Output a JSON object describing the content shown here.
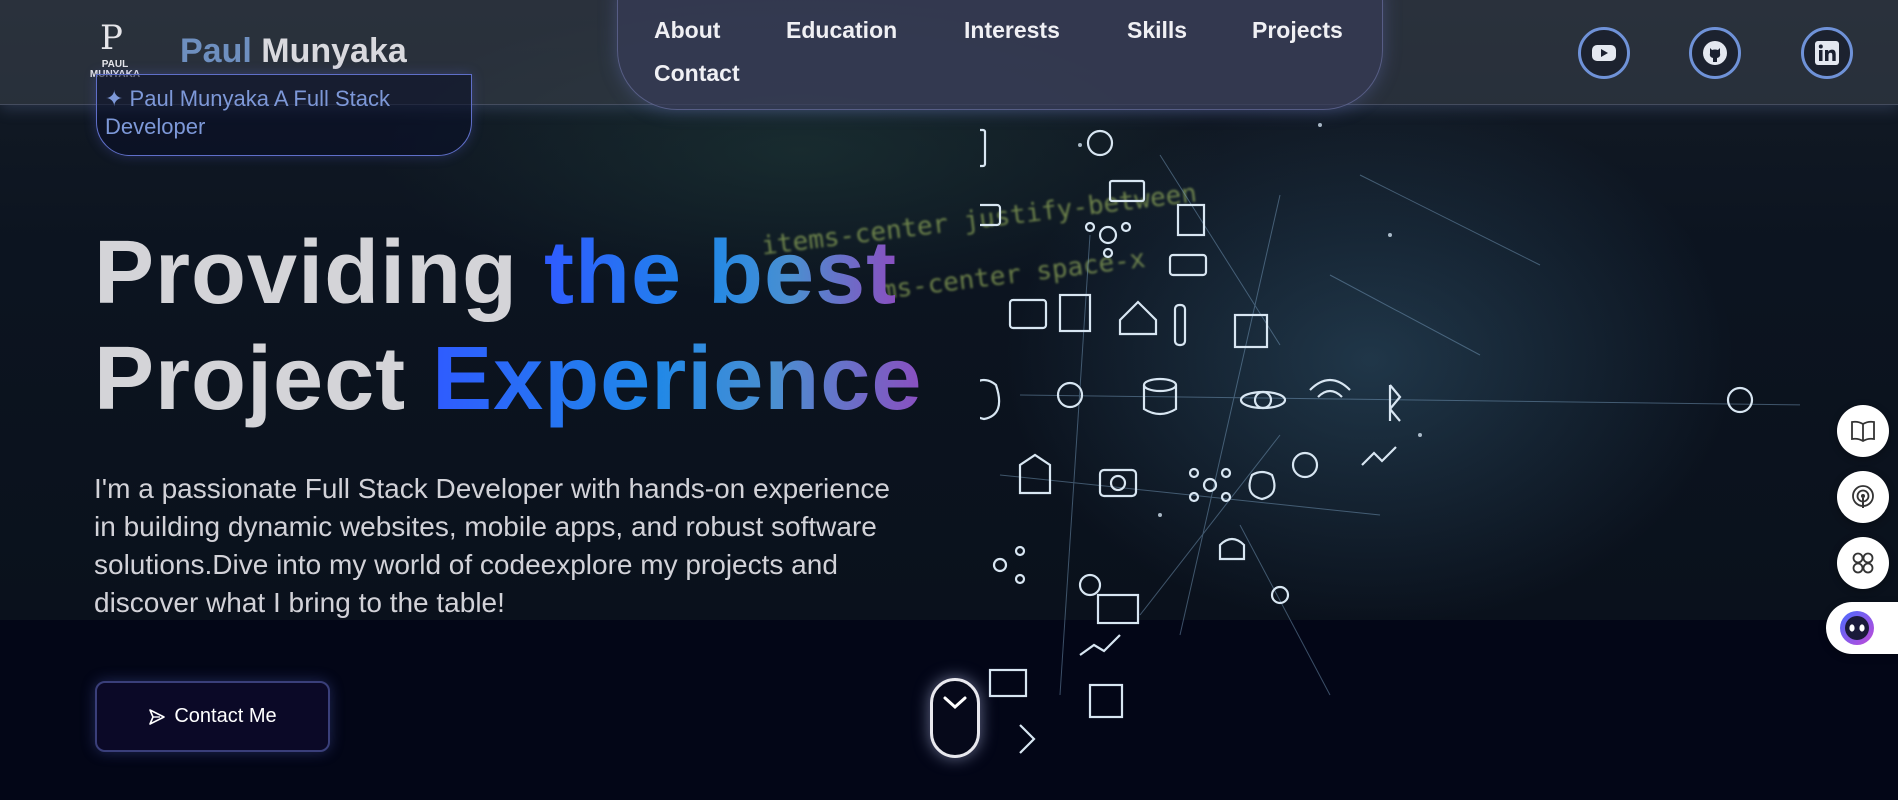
{
  "brand": {
    "logo_text": "PAUL\nMUNYAKA",
    "first_name": "Paul",
    "last_name": "Munyaka"
  },
  "nav": {
    "items": [
      "About",
      "Education",
      "Interests",
      "Skills",
      "Projects",
      "Contact"
    ]
  },
  "social": {
    "icons": [
      "youtube-icon",
      "github-icon",
      "linkedin-icon"
    ],
    "accent": "#6f92d8"
  },
  "hero": {
    "intro_pill": "✦ Paul Munyaka A Full Stack Developer",
    "headline": {
      "line1_plain": "Providing ",
      "line1_highlight": "the best",
      "line2_plain": "Project ",
      "line2_highlight": "Experience"
    },
    "description": "I'm a passionate Full Stack Developer with hands-on experience in building dynamic websites, mobile apps, and robust software solutions.Dive into my world of codeexplore my projects and discover what I bring to the table!",
    "contact_button": "Contact Me",
    "contact_icon": "send-icon",
    "scroll_icon": "chevron-down-icon"
  },
  "code_background": [
    "items-center justify-between",
    "ms-center space-x"
  ],
  "floating_tools": [
    "reader-icon",
    "podcast-icon",
    "apps-icon",
    "assistant-icon"
  ],
  "colors": {
    "gradient_start": "#2f5bff",
    "gradient_mid": "#1f88e8",
    "gradient_end": "#8a4fc0",
    "page_background": "#030617"
  }
}
